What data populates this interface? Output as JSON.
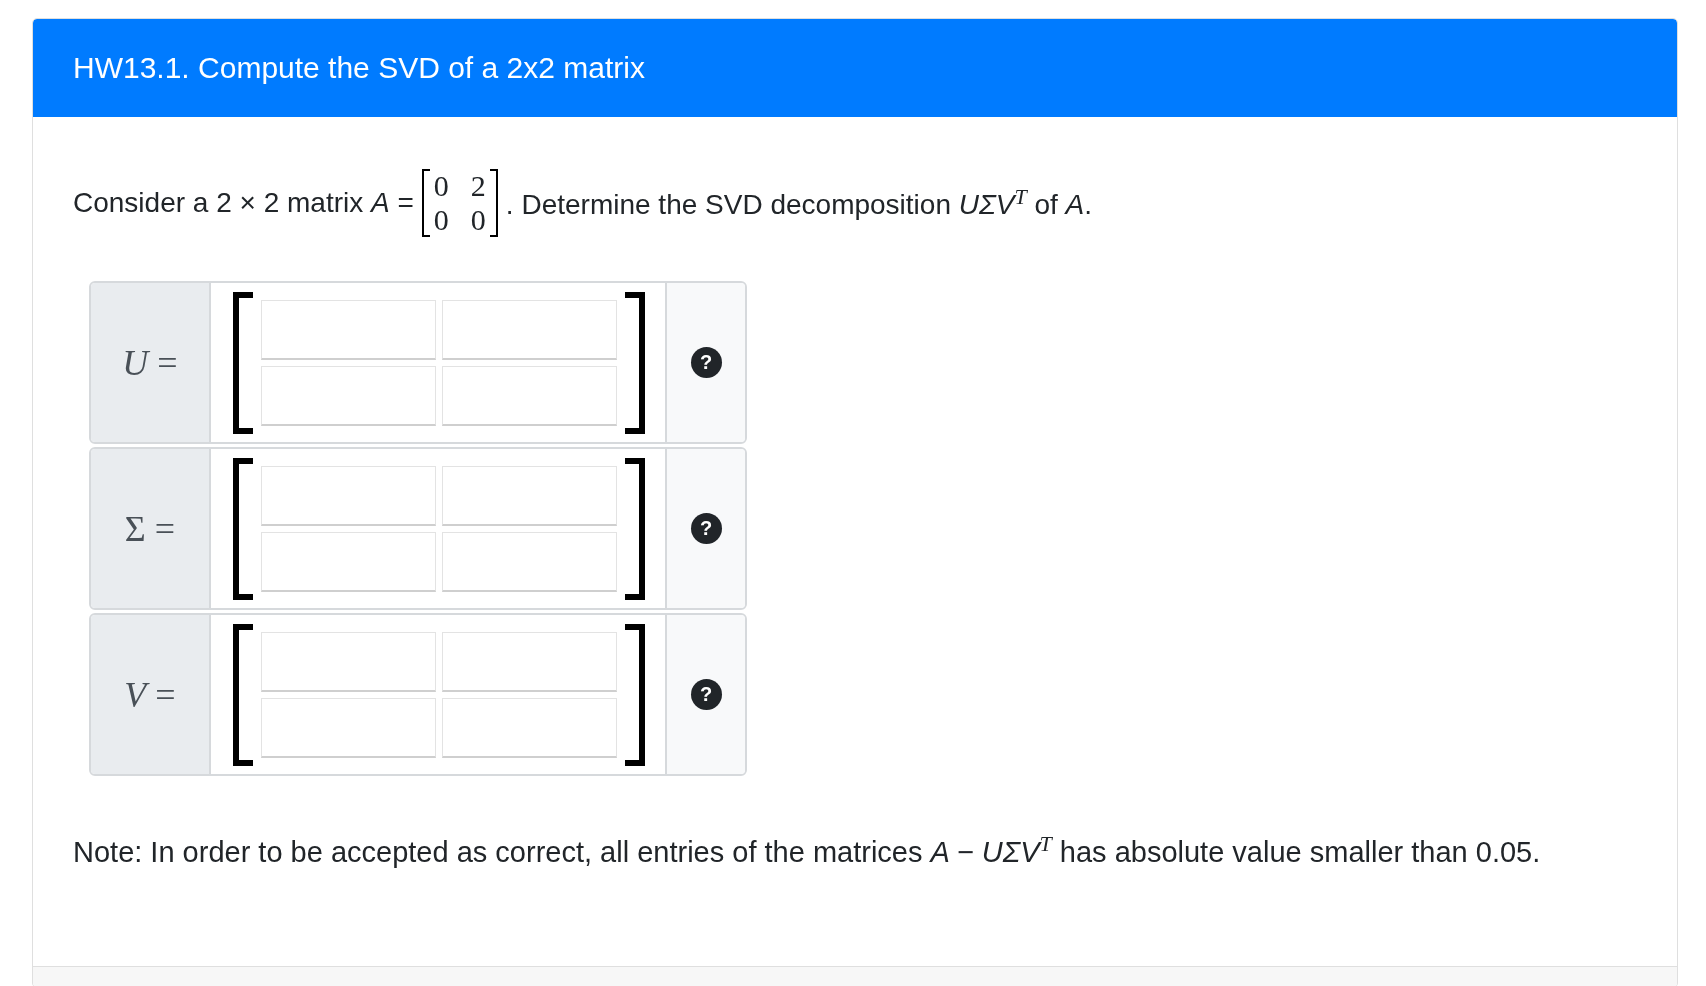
{
  "header": {
    "title": "HW13.1. Compute the SVD of a 2x2 matrix"
  },
  "question": {
    "before": "Consider a 2 × 2 matrix *A* =",
    "matrix": [
      [
        "0",
        "2"
      ],
      [
        "0",
        "0"
      ]
    ],
    "after": ". Determine the SVD decomposition *UΣV*$^{T}$ of *A*."
  },
  "answers": [
    {
      "label": "*U* =",
      "help": "?"
    },
    {
      "label": "Σ =",
      "help": "?"
    },
    {
      "label": "*V* =",
      "help": "?"
    }
  ],
  "note": "Note: In order to be accepted as correct, all entries of the matrices *A − UΣV*$^{T}$ has absolute value smaller than 0.05."
}
